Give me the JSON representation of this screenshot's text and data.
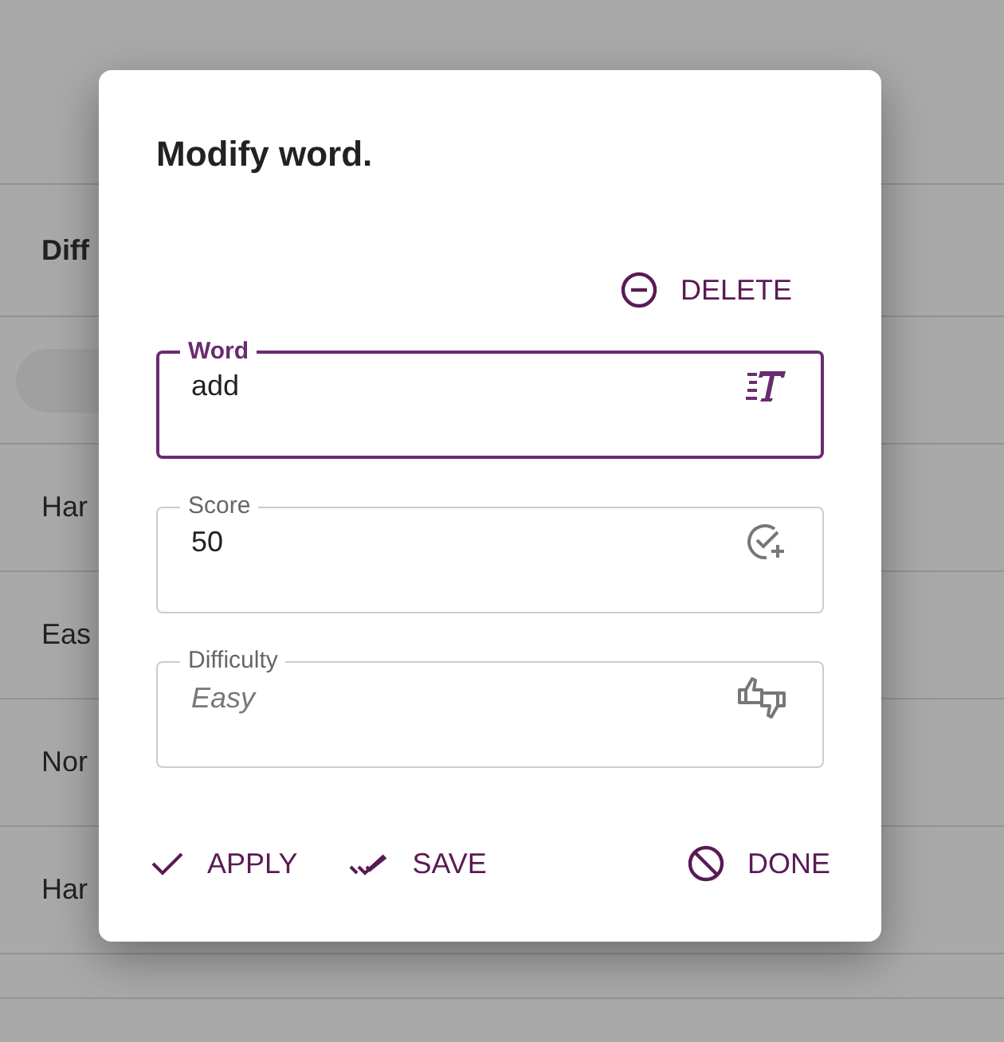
{
  "background": {
    "column_header": "Diff",
    "rows": [
      "Har",
      "Eas",
      "Nor",
      "Har"
    ]
  },
  "dialog": {
    "title": "Modify word.",
    "delete_button": "DELETE",
    "fields": [
      {
        "kind": "text",
        "label": "Word",
        "value": "add",
        "focused": true
      },
      {
        "kind": "number",
        "label": "Score",
        "value": "50",
        "focused": false
      },
      {
        "kind": "select",
        "label": "Difficulty",
        "placeholder": "Easy",
        "focused": false
      }
    ],
    "actions": [
      {
        "kind": "apply",
        "label": "APPLY"
      },
      {
        "kind": "save",
        "label": "SAVE"
      },
      {
        "kind": "done",
        "label": "DONE"
      }
    ]
  }
}
